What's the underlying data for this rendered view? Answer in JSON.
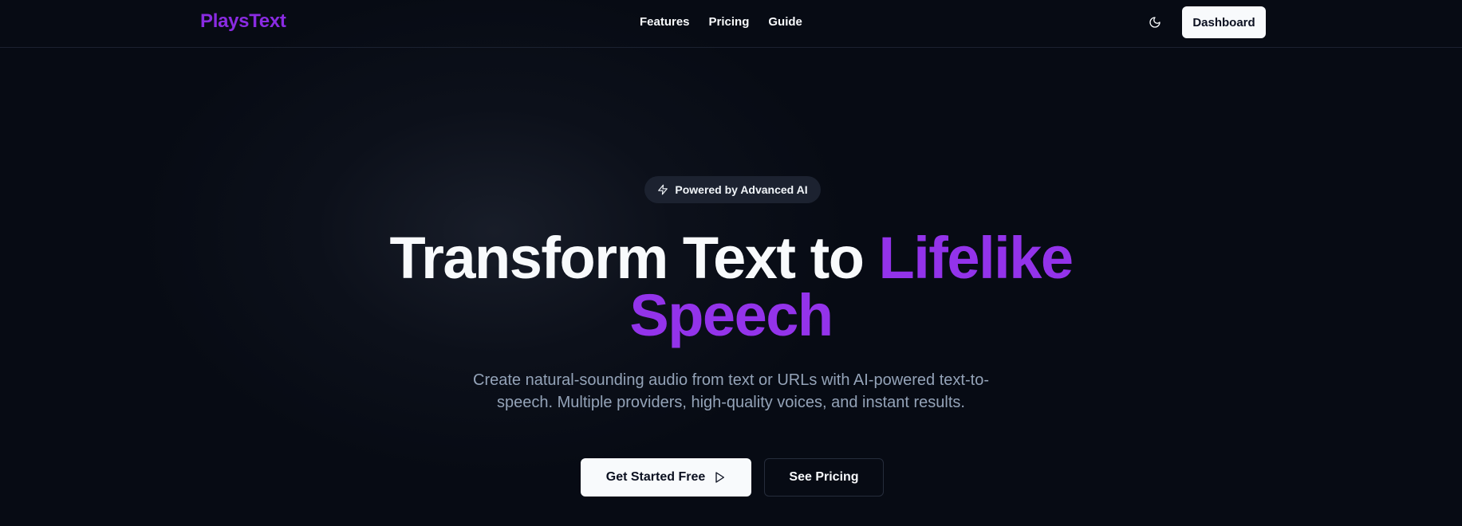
{
  "header": {
    "logo": "PlaysText",
    "nav": [
      {
        "label": "Features"
      },
      {
        "label": "Pricing"
      },
      {
        "label": "Guide"
      }
    ],
    "theme_toggle_icon": "moon-icon",
    "dashboard_label": "Dashboard"
  },
  "hero": {
    "badge": {
      "icon": "lightning-icon",
      "text": "Powered by Advanced AI"
    },
    "headline_plain": "Transform Text to ",
    "headline_highlight_1": "Lifelike",
    "headline_highlight_2": "Speech",
    "subtitle": "Create natural-sounding audio from text or URLs with AI-powered text-to-speech. Multiple providers, high-quality voices, and instant results.",
    "primary_cta": {
      "label": "Get Started Free",
      "icon": "play-icon"
    },
    "secondary_cta": {
      "label": "See Pricing"
    }
  },
  "colors": {
    "background": "#070b14",
    "brand": "#8a2be2",
    "highlight": "#9333ea",
    "muted_text": "#94a3b8"
  }
}
